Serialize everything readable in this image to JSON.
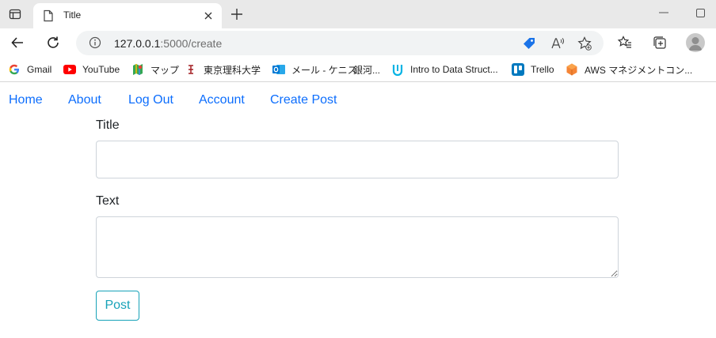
{
  "browser": {
    "tab": {
      "title": "Title"
    },
    "address": {
      "host": "127.0.0.1",
      "path": ":5000/create"
    },
    "bookmarks": [
      {
        "label": "Gmail",
        "icon": "google-icon"
      },
      {
        "label": "YouTube",
        "icon": "youtube-icon"
      },
      {
        "label": "マップ",
        "icon": "maps-icon"
      },
      {
        "label": "東京理科大学",
        "icon": "university-icon"
      },
      {
        "label": "メール - ケニス",
        "icon": "outlook-icon"
      },
      {
        "label": "銀河...",
        "icon": "none"
      },
      {
        "label": "Intro to Data Struct...",
        "icon": "udacity-icon"
      },
      {
        "label": "Trello",
        "icon": "trello-icon"
      },
      {
        "label": "AWS マネジメントコン...",
        "icon": "aws-icon"
      }
    ],
    "colors": {
      "tabstrip": "#e9e9e9",
      "omnibox": "#f1f3f4"
    }
  },
  "nav": {
    "items": [
      "Home",
      "About",
      "Log Out",
      "Account",
      "Create Post"
    ],
    "link_color": "#0d6efd"
  },
  "form": {
    "title_label": "Title",
    "title_value": "",
    "text_label": "Text",
    "text_value": "",
    "submit_label": "Post",
    "submit_color": "#17a2b8"
  }
}
